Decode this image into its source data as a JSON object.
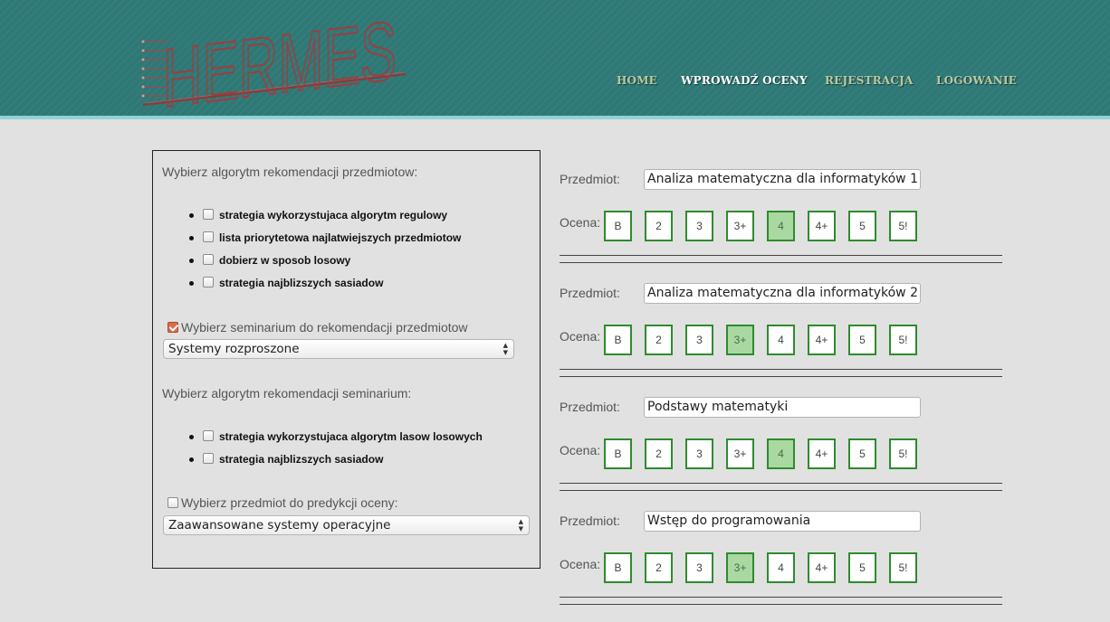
{
  "header": {
    "logo_text": "HERMES",
    "nav": [
      {
        "label": "HOME",
        "active": false
      },
      {
        "label": "WPROWADŹ OCENY",
        "active": true
      },
      {
        "label": "REJESTRACJA",
        "active": false
      },
      {
        "label": "LOGOWANIE",
        "active": false
      }
    ]
  },
  "left_panel": {
    "subject_algo_label": "Wybierz algorytm rekomendacji przedmiotow:",
    "subject_algos": [
      {
        "label": "strategia wykorzystujaca algorytm regulowy",
        "checked": false
      },
      {
        "label": "lista priorytetowa najlatwiejszych przedmiotow",
        "checked": false
      },
      {
        "label": "dobierz w sposob losowy",
        "checked": false
      },
      {
        "label": "strategia najblizszych sasiadow",
        "checked": false
      }
    ],
    "seminar_checkbox_label": "Wybierz seminarium do rekomendacji przedmiotow",
    "seminar_checkbox_checked": true,
    "seminar_select_value": "Systemy rozproszone",
    "seminar_algo_label": "Wybierz algorytm rekomendacji seminarium:",
    "seminar_algos": [
      {
        "label": "strategia wykorzystujaca algorytm lasow losowych",
        "checked": false
      },
      {
        "label": "strategia najblizszych sasiadow",
        "checked": false
      }
    ],
    "predict_checkbox_label": "Wybierz przedmiot do predykcji oceny:",
    "predict_checkbox_checked": false,
    "predict_select_value": "Zaawansowane systemy operacyjne"
  },
  "grades_form": {
    "subject_label": "Przedmiot:",
    "grade_label": "Ocena:",
    "grade_options": [
      "B",
      "2",
      "3",
      "3+",
      "4",
      "4+",
      "5",
      "5!"
    ],
    "subjects": [
      {
        "name": "Analiza matematyczna dla informatyków 1",
        "selected": "4"
      },
      {
        "name": "Analiza matematyczna dla informatyków 2",
        "selected": "3+"
      },
      {
        "name": "Podstawy matematyki",
        "selected": "4"
      },
      {
        "name": "Wstęp do programowania",
        "selected": "3+"
      }
    ]
  },
  "colors": {
    "header_bg": "#2e7876",
    "header_border": "#8fd3d3",
    "grade_border": "#2e8b2e",
    "grade_selected": "#a9d9a1",
    "logo": "#8b3a3a"
  }
}
